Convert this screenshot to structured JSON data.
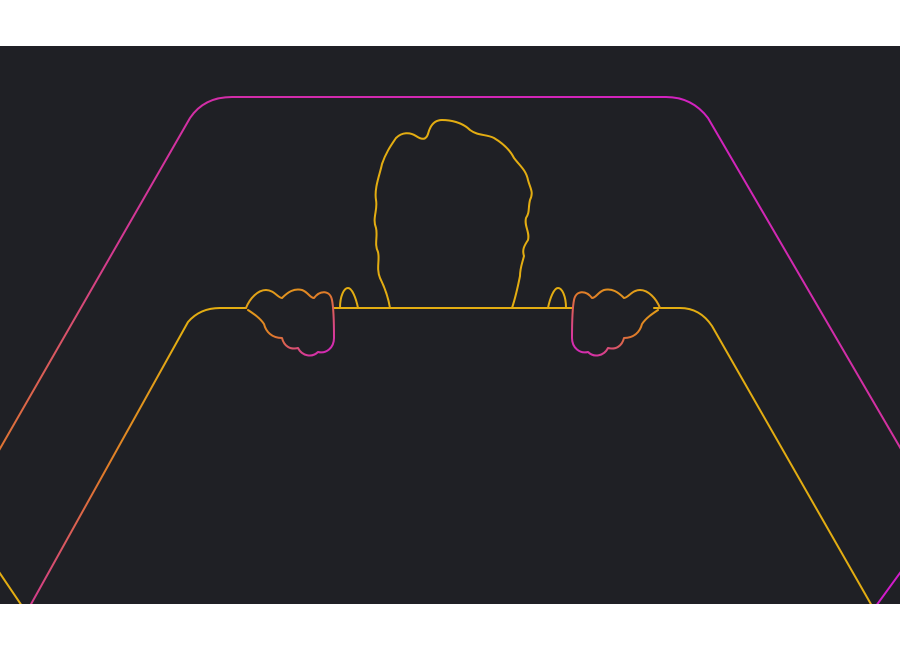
{
  "scene": {
    "description_role": "decorative-illustration",
    "background_color": "#1f2025",
    "frame_color": "#ffffff",
    "accent_colors": {
      "magenta": "#d21ccb",
      "pink": "#d33a8f",
      "orange": "#e0792a",
      "gold": "#e3ad12"
    }
  }
}
